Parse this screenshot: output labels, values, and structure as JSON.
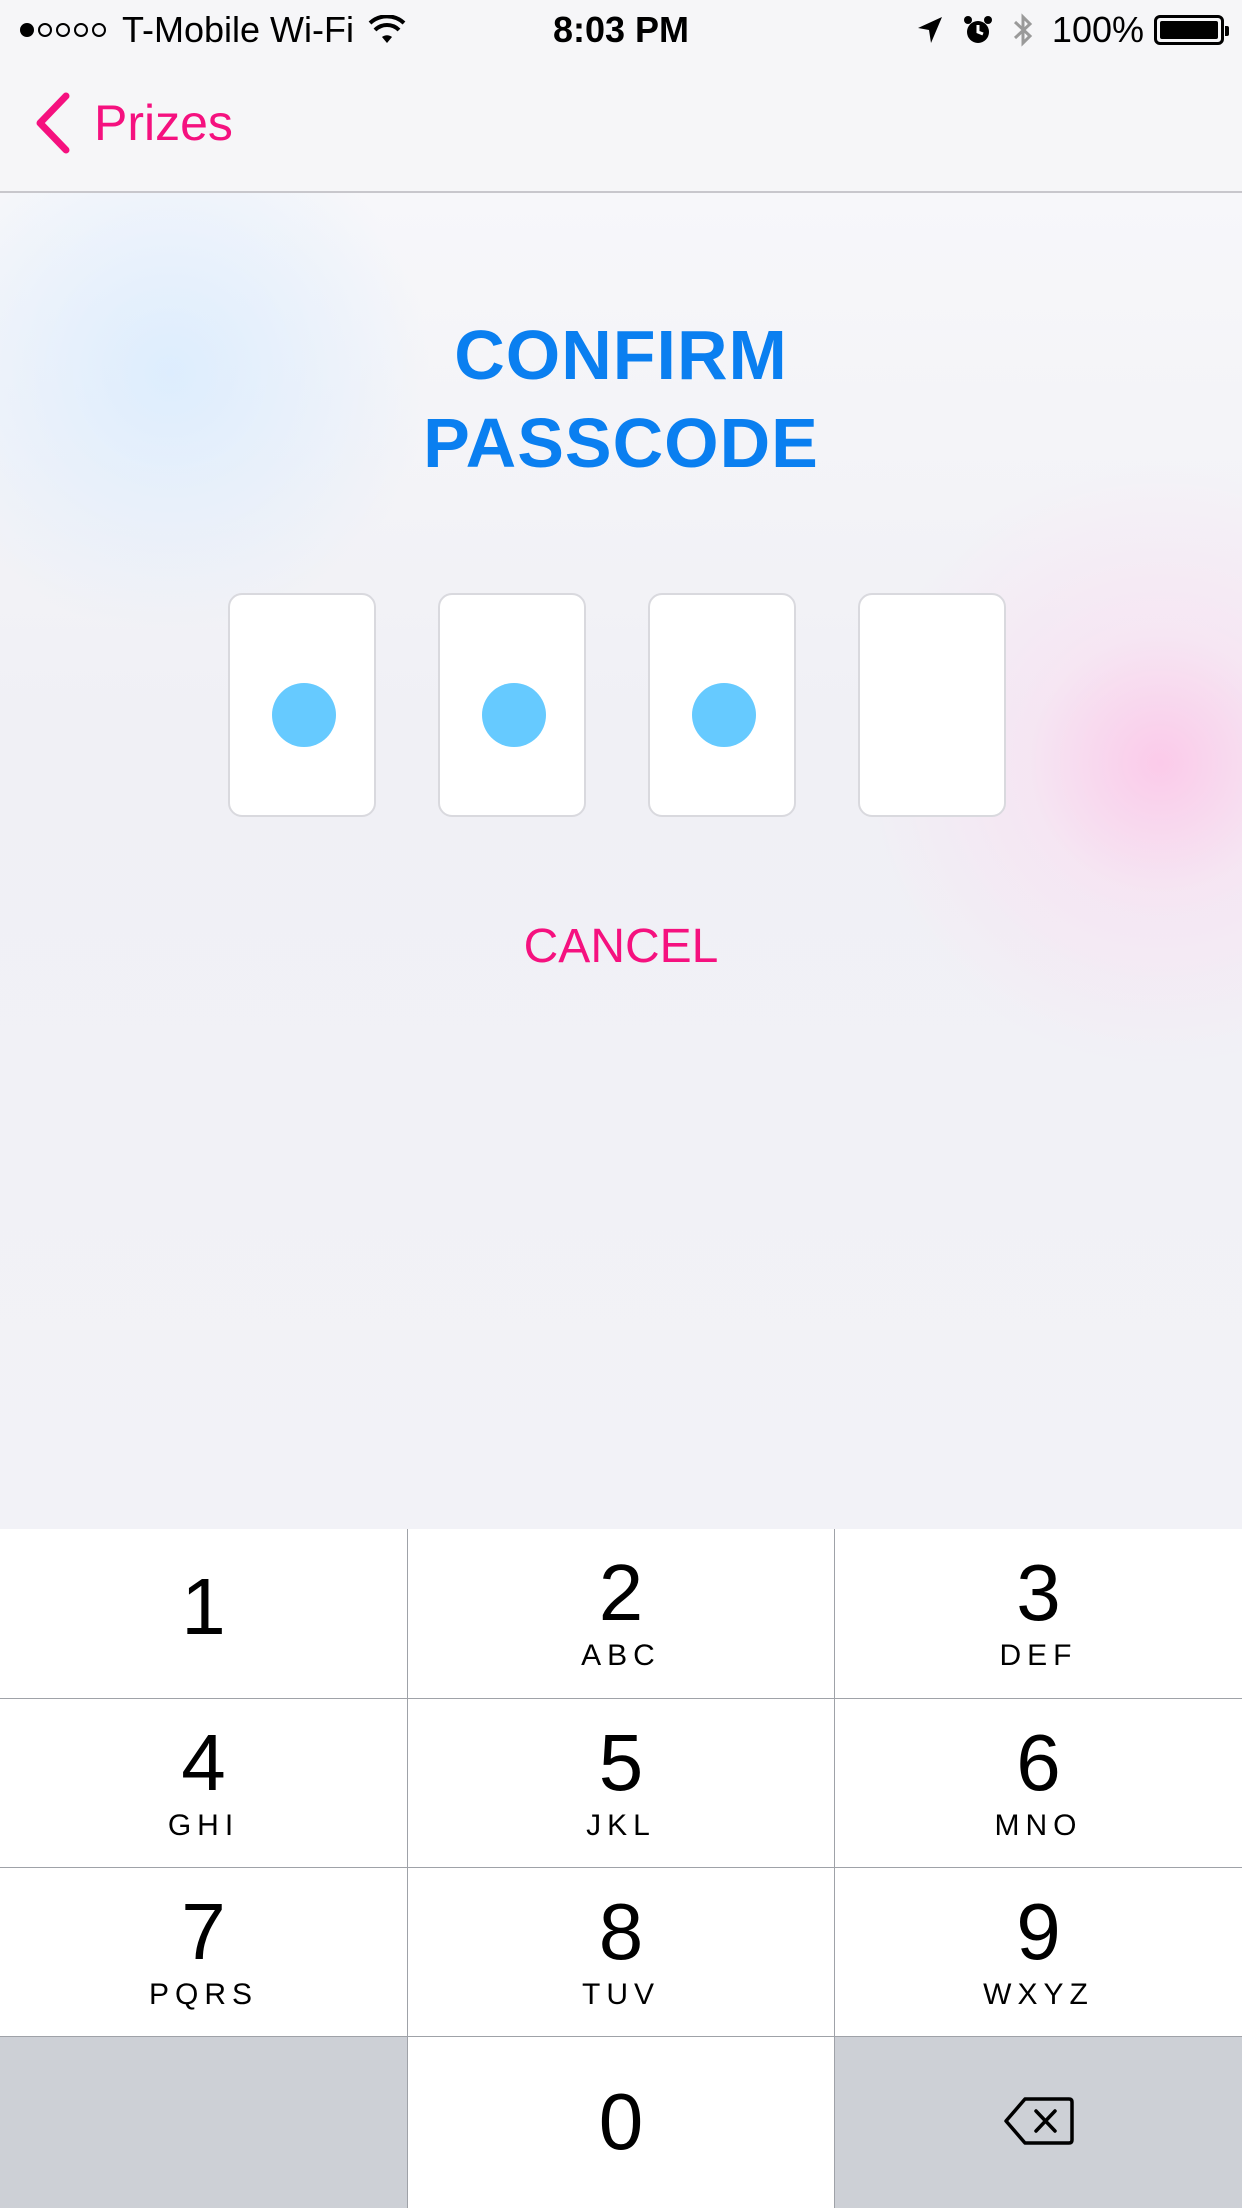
{
  "status_bar": {
    "carrier": "T-Mobile Wi-Fi",
    "time": "8:03 PM",
    "battery": "100%",
    "signal_bars_filled": 1,
    "signal_bars_total": 5,
    "icons": [
      "wifi-icon",
      "location-arrow-icon",
      "alarm-icon",
      "bluetooth-icon",
      "battery-icon"
    ]
  },
  "nav": {
    "back_label": "Prizes"
  },
  "title": {
    "line1": "CONFIRM",
    "line2": "PASSCODE"
  },
  "passcode": {
    "length": 4,
    "filled": 3
  },
  "cancel_label": "CANCEL",
  "keypad": {
    "keys": [
      {
        "digit": "1",
        "letters": ""
      },
      {
        "digit": "2",
        "letters": "ABC"
      },
      {
        "digit": "3",
        "letters": "DEF"
      },
      {
        "digit": "4",
        "letters": "GHI"
      },
      {
        "digit": "5",
        "letters": "JKL"
      },
      {
        "digit": "6",
        "letters": "MNO"
      },
      {
        "digit": "7",
        "letters": "PQRS"
      },
      {
        "digit": "8",
        "letters": "TUV"
      },
      {
        "digit": "9",
        "letters": "WXYZ"
      },
      {
        "digit": "0",
        "letters": ""
      }
    ]
  },
  "colors": {
    "accent_pink": "#f5117f",
    "title_blue": "#0a7ff0",
    "dot_blue": "#66caff",
    "key_gray": "#cdd0d6"
  }
}
